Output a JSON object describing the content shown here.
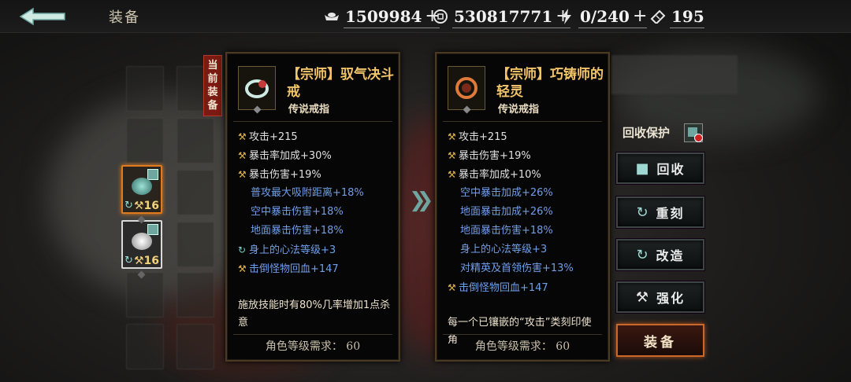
{
  "header": {
    "title": "装备",
    "resources": [
      {
        "icon": "ingot-icon",
        "value": "1509984"
      },
      {
        "icon": "coin-icon",
        "value": "530817771"
      },
      {
        "icon": "lightning-icon",
        "value": "0/240"
      },
      {
        "icon": "ticket-icon",
        "value": "195"
      }
    ]
  },
  "inventory": {
    "current_tag": "当前装备",
    "slots": [
      {
        "level": "16",
        "state": "active",
        "colors": {
          "gem": "#5fb3a8"
        }
      },
      {
        "level": "16",
        "state": "selected",
        "colors": {
          "gem": "#d8d8d8"
        }
      }
    ]
  },
  "current_item": {
    "name": "【宗师】驭气决斗戒",
    "type": "传说戒指",
    "stats": [
      {
        "text": "攻击+215",
        "kind": "main",
        "icon": "hammer-icon"
      },
      {
        "text": "暴击率加成+30%",
        "kind": "main",
        "icon": "hammer-icon"
      },
      {
        "text": "暴击伤害+19%",
        "kind": "main",
        "icon": "hammer-icon"
      },
      {
        "text": "普攻最大吸附距离+18%",
        "kind": "blue",
        "icon": ""
      },
      {
        "text": "空中暴击伤害+18%",
        "kind": "blue",
        "icon": ""
      },
      {
        "text": "地面暴击伤害+18%",
        "kind": "blue",
        "icon": ""
      },
      {
        "text": "身上的心法等级+3",
        "kind": "blue-cycle",
        "icon": "cycle-icon"
      },
      {
        "text": "击倒怪物回血+147",
        "kind": "blue-hammer",
        "icon": "hammer-icon"
      }
    ],
    "effect": "施放技能时有80%几率增加1点杀意",
    "requirement": "角色等级需求： 60"
  },
  "compare_item": {
    "name": "【宗师】巧铸师的轻灵",
    "type": "传说戒指",
    "stats": [
      {
        "text": "攻击+215",
        "kind": "main",
        "icon": "hammer-icon"
      },
      {
        "text": "暴击伤害+19%",
        "kind": "main",
        "icon": "hammer-icon"
      },
      {
        "text": "暴击率加成+10%",
        "kind": "main",
        "icon": "hammer-icon"
      },
      {
        "text": "空中暴击加成+26%",
        "kind": "blue",
        "icon": ""
      },
      {
        "text": "地面暴击加成+26%",
        "kind": "blue",
        "icon": ""
      },
      {
        "text": "地面暴击伤害+18%",
        "kind": "blue",
        "icon": ""
      },
      {
        "text": "身上的心法等级+3",
        "kind": "blue",
        "icon": ""
      },
      {
        "text": "对精英及首领伤害+13%",
        "kind": "blue",
        "icon": ""
      },
      {
        "text": "击倒怪物回血+147",
        "kind": "blue-hammer",
        "icon": "hammer-icon"
      }
    ],
    "effect": "每一个已镶嵌的“攻击”类刻印使角",
    "requirement": "角色等级需求： 60"
  },
  "actions": {
    "recycle_protect": "回收保护",
    "recycle": "回收",
    "reengrave": "重刻",
    "modify": "改造",
    "enhance": "强化",
    "equip": "装备"
  },
  "colors": {
    "gold_title": "#f3c56a",
    "blue_stat": "#6f9fe8",
    "accent_orange": "#e07a1c",
    "equip_border": "#c9682a"
  }
}
